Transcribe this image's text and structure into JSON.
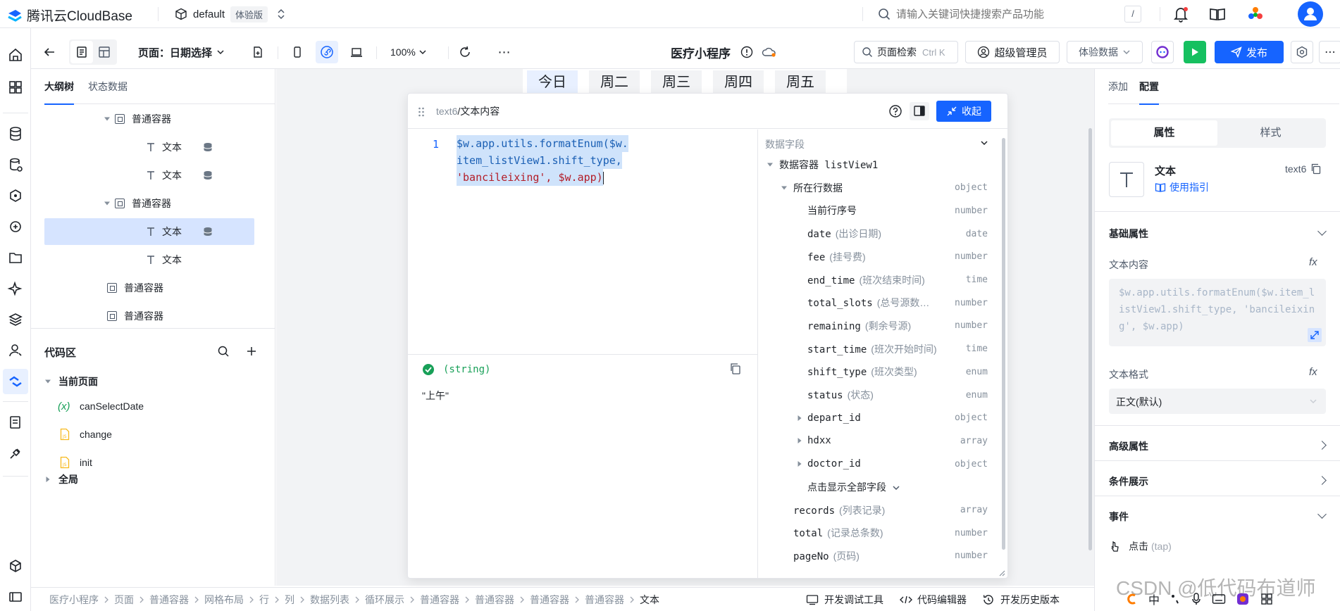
{
  "app": {
    "brand": "腾讯云CloudBase",
    "env_name": "default",
    "env_badge": "体验版"
  },
  "search": {
    "placeholder": "请输入关键词快捷搜索产品功能",
    "shortcut": "/"
  },
  "toolbar": {
    "page_label": "页面：日期选择",
    "zoom": "100%",
    "app_title": "医疗小程序",
    "page_search_label": "页面检索",
    "page_search_shortcut": "Ctrl K",
    "admin_label": "超级管理员",
    "data_mode": "体验数据",
    "publish_label": "发布"
  },
  "outline": {
    "tabs": [
      "大纲树",
      "状态数据"
    ],
    "rows": [
      {
        "label": "普通容器",
        "kind": "container",
        "level": 2,
        "expanded": true,
        "db": false,
        "selected": false
      },
      {
        "label": "文本",
        "kind": "text",
        "level": 3,
        "expanded": null,
        "db": true,
        "selected": false
      },
      {
        "label": "文本",
        "kind": "text",
        "level": 3,
        "expanded": null,
        "db": true,
        "selected": false
      },
      {
        "label": "普通容器",
        "kind": "container",
        "level": 2,
        "expanded": true,
        "db": false,
        "selected": false
      },
      {
        "label": "文本",
        "kind": "text",
        "level": 3,
        "expanded": null,
        "db": true,
        "selected": true
      },
      {
        "label": "文本",
        "kind": "text",
        "level": 3,
        "expanded": null,
        "db": false,
        "selected": false
      },
      {
        "label": "普通容器",
        "kind": "container",
        "level": 1,
        "expanded": null,
        "db": false,
        "selected": false
      },
      {
        "label": "普通容器",
        "kind": "container",
        "level": 1,
        "expanded": null,
        "db": false,
        "selected": false
      }
    ]
  },
  "code_area": {
    "title": "代码区",
    "current_page": "当前页面",
    "items": [
      {
        "label": "canSelectDate",
        "kind": "var"
      },
      {
        "label": "change",
        "kind": "js"
      },
      {
        "label": "init",
        "kind": "js"
      }
    ],
    "global": "全局"
  },
  "preview": {
    "days": [
      "今日",
      "周二",
      "周三",
      "周四",
      "周五"
    ]
  },
  "editor": {
    "breadcrumb_component": "text6",
    "breadcrumb_prop": "文本内容",
    "collapse_label": "收起",
    "line_number": "1",
    "code_lines": [
      "$w.app.utils.formatEnum($w.",
      "item_listView1.shift_type,",
      "'bancileixing', $w.app)"
    ],
    "result_type": "(string)",
    "result_value": "\"上午\"",
    "fields_title": "数据字段",
    "fields": [
      {
        "name": "数据容器 listView1",
        "desc": "",
        "type": "",
        "level": 0,
        "caret": "down"
      },
      {
        "name": "所在行数据",
        "desc": "",
        "type": "object",
        "level": 1,
        "caret": "down"
      },
      {
        "name": "当前行序号",
        "desc": "",
        "type": "number",
        "level": 2,
        "caret": ""
      },
      {
        "name": "date",
        "desc": "(出诊日期)",
        "type": "date",
        "level": 2,
        "caret": ""
      },
      {
        "name": "fee",
        "desc": "(挂号费)",
        "type": "number",
        "level": 2,
        "caret": ""
      },
      {
        "name": "end_time",
        "desc": "(班次结束时间)",
        "type": "time",
        "level": 2,
        "caret": ""
      },
      {
        "name": "total_slots",
        "desc": "(总号源数…",
        "type": "number",
        "level": 2,
        "caret": ""
      },
      {
        "name": "remaining",
        "desc": "(剩余号源)",
        "type": "number",
        "level": 2,
        "caret": ""
      },
      {
        "name": "start_time",
        "desc": "(班次开始时间)",
        "type": "time",
        "level": 2,
        "caret": ""
      },
      {
        "name": "shift_type",
        "desc": "(班次类型)",
        "type": "enum",
        "level": 2,
        "caret": ""
      },
      {
        "name": "status",
        "desc": "(状态)",
        "type": "enum",
        "level": 2,
        "caret": ""
      },
      {
        "name": "depart_id",
        "desc": "",
        "type": "object",
        "level": 2,
        "caret": "right"
      },
      {
        "name": "hdxx",
        "desc": "",
        "type": "array",
        "level": 2,
        "caret": "right"
      },
      {
        "name": "doctor_id",
        "desc": "",
        "type": "object",
        "level": 2,
        "caret": "right"
      },
      {
        "name": "点击显示全部字段",
        "desc": "",
        "type": "",
        "level": 2,
        "caret": "showall"
      },
      {
        "name": "records",
        "desc": "(列表记录)",
        "type": "array",
        "level": 1,
        "caret": ""
      },
      {
        "name": "total",
        "desc": "(记录总条数)",
        "type": "number",
        "level": 1,
        "caret": ""
      },
      {
        "name": "pageNo",
        "desc": "(页码)",
        "type": "number",
        "level": 1,
        "caret": ""
      }
    ]
  },
  "right": {
    "tabs": [
      "添加",
      "配置"
    ],
    "seg": [
      "属性",
      "样式"
    ],
    "component_name": "文本",
    "component_id": "text6",
    "guide_link": "使用指引",
    "basic_title": "基础属性",
    "text_content_label": "文本内容",
    "text_content_value": "$w.app.utils.formatEnum($w.item_listView1.shift_type, 'bancileixing', $w.app)",
    "text_format_label": "文本格式",
    "text_format_value": "正文(默认)",
    "advanced_title": "高级属性",
    "condition_title": "条件展示",
    "events_title": "事件",
    "event_click": "点击",
    "event_tap": "(tap)"
  },
  "statusbar": {
    "crumbs": [
      "医疗小程序",
      "页面",
      "普通容器",
      "网格布局",
      "行",
      "列",
      "数据列表",
      "循环展示",
      "普通容器",
      "普通容器",
      "普通容器",
      "普通容器",
      "文本"
    ],
    "tools": [
      "开发调试工具",
      "代码编辑器",
      "开发历史版本"
    ]
  },
  "watermark": "CSDN @低代码布道师",
  "colors": {
    "primary": "#1664ff",
    "selected_row": "#d6e4ff",
    "code_highlight": "#cfe3fb",
    "success": "#18a058",
    "run": "#16c060"
  }
}
